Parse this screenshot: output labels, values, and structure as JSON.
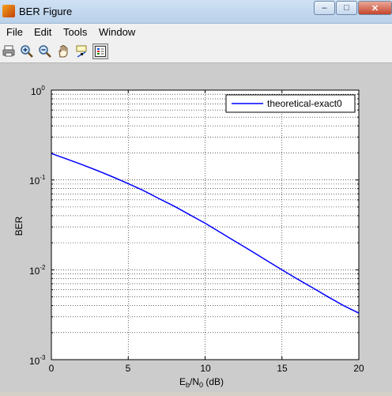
{
  "window": {
    "title": "BER Figure",
    "minimize": "–",
    "maximize": "□",
    "close": "✕"
  },
  "menu": [
    "File",
    "Edit",
    "Tools",
    "Window"
  ],
  "toolbar": [
    {
      "icon": "print-icon"
    },
    {
      "icon": "zoom-in-icon"
    },
    {
      "icon": "zoom-out-icon"
    },
    {
      "icon": "pan-hand-icon"
    },
    {
      "icon": "data-cursor-icon"
    },
    {
      "icon": "legend-toggle-icon",
      "active": true
    }
  ],
  "chart_data": {
    "type": "line",
    "xlabel": {
      "base": "E",
      "sub1": "b",
      "mid": "/N",
      "sub2": "0",
      "tail": " (dB)"
    },
    "ylabel": "BER",
    "xlim": [
      0,
      20
    ],
    "ylim": [
      0.001,
      1
    ],
    "yscale": "log",
    "grid": true,
    "grid_style": "dotted",
    "legend_position": "top-right",
    "xticks": [
      "0",
      "5",
      "10",
      "15",
      "20"
    ],
    "yticks": [
      {
        "base": "10",
        "exp": "0"
      },
      {
        "base": "10",
        "exp": "-1"
      },
      {
        "base": "10",
        "exp": "-2"
      },
      {
        "base": "10",
        "exp": "-3"
      }
    ],
    "series": [
      {
        "name": "theoretical-exact0",
        "color": "#0000ff",
        "x": [
          0,
          1,
          2,
          3,
          4,
          5,
          6,
          7,
          8,
          9,
          10,
          11,
          12,
          13,
          14,
          15,
          16,
          17,
          18,
          19,
          20
        ],
        "y": [
          0.197,
          0.171,
          0.148,
          0.127,
          0.108,
          0.091,
          0.076,
          0.062,
          0.051,
          0.041,
          0.033,
          0.026,
          0.0205,
          0.0162,
          0.0127,
          0.01,
          0.0079,
          0.0063,
          0.005,
          0.004,
          0.0033
        ]
      }
    ]
  }
}
